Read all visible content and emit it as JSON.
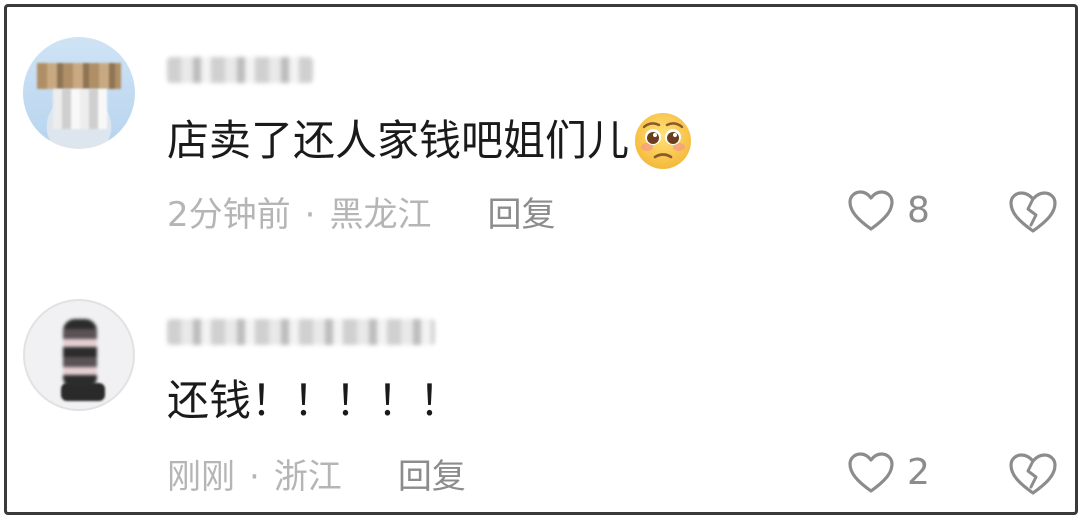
{
  "comments": [
    {
      "username": "Running",
      "text": "店卖了还人家钱吧姐们儿",
      "emoji": "pleading-face-emoji",
      "time": "2分钟前",
      "separator": "·",
      "location": "黑龙江",
      "reply_label": "回复",
      "like_count": "8"
    },
    {
      "username": "一",
      "text": "还钱！！！！！",
      "time": "刚刚",
      "separator": "·",
      "location": "浙江",
      "reply_label": "回复",
      "like_count": "2"
    }
  ],
  "icons": {
    "like": "heart-outline-icon",
    "dislike": "broken-heart-outline-icon"
  },
  "colors": {
    "text_primary": "#1a1a1a",
    "text_meta": "#b5b5b5",
    "text_action": "#8c8c8c",
    "icon_stroke": "#8c8c8c",
    "frame_border": "#3a3a3a"
  }
}
